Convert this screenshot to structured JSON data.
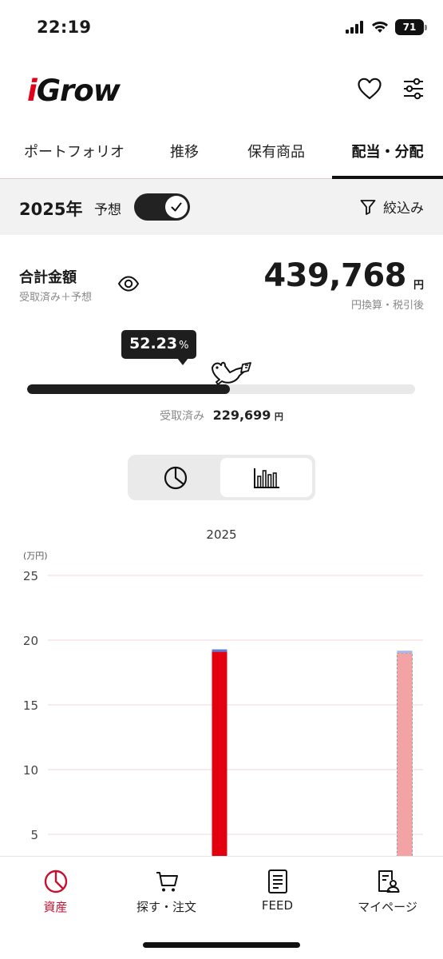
{
  "status": {
    "time": "22:19",
    "battery": "71"
  },
  "app": {
    "logo_i": "i",
    "logo_rest": "Grow"
  },
  "tabs": [
    {
      "label": "ポートフォリオ"
    },
    {
      "label": "推移"
    },
    {
      "label": "保有商品"
    },
    {
      "label": "配当・分配",
      "active": true
    }
  ],
  "filter": {
    "year": "2025年",
    "forecast_label": "予想",
    "forecast_on": true,
    "filter_label": "絞込み"
  },
  "summary": {
    "title": "合計金額",
    "subtitle": "受取済み＋予想",
    "amount": "439,768",
    "unit": "円",
    "note": "円換算・税引後",
    "received_pct": "52.23",
    "pct_sign": "%",
    "progress_fraction": 0.5223,
    "received_label": "受取済み",
    "received_amount": "229,699",
    "received_unit": "円"
  },
  "chart_data": {
    "type": "bar",
    "title": "2025",
    "ylabel": "(万円)",
    "ylim": [
      0,
      25
    ],
    "yticks": [
      "5",
      "10",
      "15",
      "20",
      "25"
    ],
    "series": [
      {
        "values": [
          19.1,
          0
        ]
      },
      {
        "values": [
          0,
          19.0
        ]
      }
    ],
    "colors": {
      "received": "#e3000f",
      "forecast": "#f4a3a5",
      "top_cap": "#5a7bd8",
      "grid": "#f6d6da"
    }
  },
  "bottom_nav": [
    {
      "label": "資産",
      "icon": "assets-pie-icon",
      "active": true
    },
    {
      "label": "探す・注文",
      "icon": "cart-icon"
    },
    {
      "label": "FEED",
      "icon": "document-icon"
    },
    {
      "label": "マイページ",
      "icon": "profile-card-icon"
    }
  ]
}
